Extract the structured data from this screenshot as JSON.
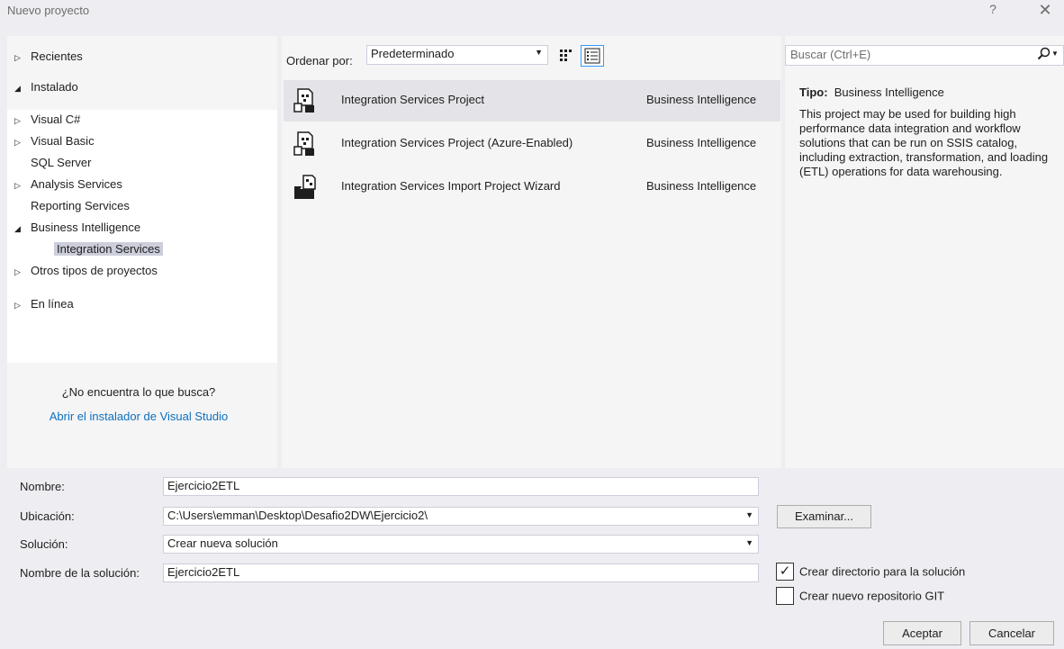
{
  "window": {
    "title": "Nuevo proyecto",
    "help_glyph": "?",
    "close_glyph": "✕"
  },
  "tree": {
    "recent": "Recientes",
    "installed": "Instalado",
    "installed_children": [
      {
        "label": "Visual C#",
        "expander": "▷"
      },
      {
        "label": "Visual Basic",
        "expander": "▷"
      },
      {
        "label": "SQL Server",
        "expander": ""
      },
      {
        "label": "Analysis Services",
        "expander": "▷"
      },
      {
        "label": "Reporting Services",
        "expander": ""
      },
      {
        "label": "Business Intelligence",
        "expander": "◢"
      },
      {
        "label": "Integration Services",
        "expander": ""
      },
      {
        "label": "Otros tipos de proyectos",
        "expander": "▷"
      }
    ],
    "online": "En línea",
    "not_found": "¿No encuentra lo que busca?",
    "installer_link": "Abrir el instalador de Visual Studio"
  },
  "sort": {
    "label": "Ordenar por:",
    "value": "Predeterminado"
  },
  "templates": [
    {
      "name": "Integration Services Project",
      "category": "Business Intelligence",
      "selected": true
    },
    {
      "name": "Integration Services Project (Azure-Enabled)",
      "category": "Business Intelligence",
      "selected": false
    },
    {
      "name": "Integration Services Import Project Wizard",
      "category": "Business Intelligence",
      "selected": false
    }
  ],
  "search": {
    "placeholder": "Buscar (Ctrl+E)"
  },
  "details": {
    "type_label": "Tipo:",
    "type_value": "Business Intelligence",
    "description": "This project may be used for building high performance data integration and workflow solutions that can be run on SSIS catalog, including extraction, transformation, and loading (ETL) operations for data warehousing."
  },
  "form": {
    "name_label": "Nombre:",
    "name_value": "Ejercicio2ETL",
    "location_label": "Ubicación:",
    "location_value": "C:\\Users\\emman\\Desktop\\Desafio2DW\\Ejercicio2\\",
    "solution_label": "Solución:",
    "solution_value": "Crear nueva solución",
    "solution_name_label": "Nombre de la solución:",
    "solution_name_value": "Ejercicio2ETL",
    "browse": "Examinar...",
    "create_dir": "Crear directorio para la solución",
    "create_dir_checked": true,
    "create_git": "Crear nuevo repositorio GIT",
    "create_git_checked": false,
    "accept": "Aceptar",
    "cancel": "Cancelar"
  },
  "colors": {
    "accent": "#3399ff",
    "link": "#0e70c0",
    "selection": "#cccedb"
  }
}
